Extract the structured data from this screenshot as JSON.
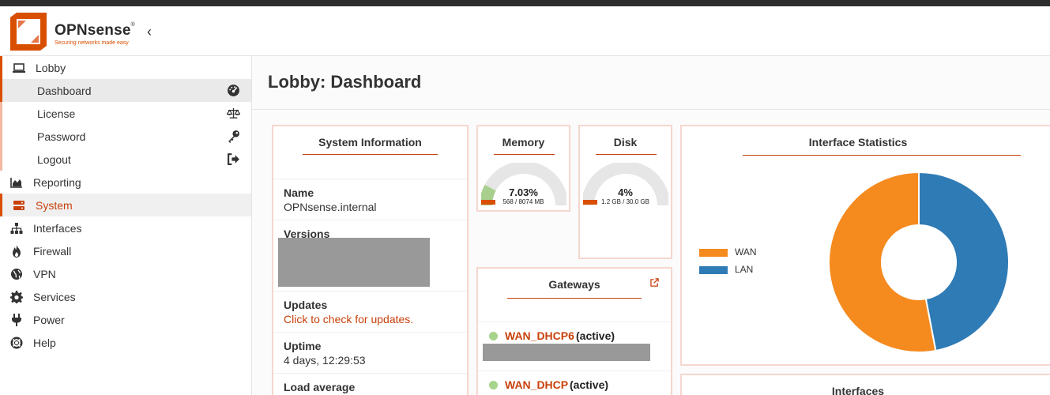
{
  "header": {
    "brand": "OPNsense",
    "brand_mark": "®",
    "tagline": "Securing networks made easy",
    "collapse_icon": "chevron-left-icon",
    "collapse_glyph": "‹"
  },
  "sidebar": {
    "lobby": {
      "label": "Lobby",
      "icon": "laptop-icon"
    },
    "lobby_items": [
      {
        "label": "Dashboard",
        "icon": "dashboard-gauge-icon"
      },
      {
        "label": "License",
        "icon": "balance-scale-icon"
      },
      {
        "label": "Password",
        "icon": "key-icon"
      },
      {
        "label": "Logout",
        "icon": "sign-out-icon"
      }
    ],
    "items": [
      {
        "label": "Reporting",
        "icon": "area-chart-icon"
      },
      {
        "label": "System",
        "icon": "server-icon"
      },
      {
        "label": "Interfaces",
        "icon": "sitemap-icon"
      },
      {
        "label": "Firewall",
        "icon": "fire-icon"
      },
      {
        "label": "VPN",
        "icon": "globe-icon"
      },
      {
        "label": "Services",
        "icon": "cog-icon"
      },
      {
        "label": "Power",
        "icon": "plug-icon"
      },
      {
        "label": "Help",
        "icon": "life-ring-icon"
      }
    ]
  },
  "page": {
    "title": "Lobby: Dashboard"
  },
  "system_info": {
    "title": "System Information",
    "rows": [
      {
        "label": "Name",
        "value": "OPNsense.internal"
      },
      {
        "label": "Versions",
        "value": ""
      },
      {
        "label": "Updates",
        "value": "Click to check for updates."
      },
      {
        "label": "Uptime",
        "value": "4 days, 12:29:53"
      },
      {
        "label": "Load average",
        "value": ""
      }
    ]
  },
  "memory": {
    "title": "Memory",
    "percent_label": "7.03%",
    "usage": "568 / 8074 MB",
    "fraction": 0.0703
  },
  "disk": {
    "title": "Disk",
    "percent_label": "4%",
    "usage": "1.2 GB / 30.0 GB",
    "fraction": 0.04
  },
  "gateways": {
    "title": "Gateways",
    "open_icon": "external-link-icon",
    "items": [
      {
        "name": "WAN_DHCP6",
        "status": "(active)"
      },
      {
        "name": "WAN_DHCP",
        "status": "(active)"
      }
    ]
  },
  "interface_stats": {
    "title": "Interface Statistics",
    "colors": {
      "WAN": "#f58a1f",
      "LAN": "#2f7bb5"
    }
  },
  "interfaces_widget": {
    "title": "Interfaces"
  },
  "chart_data": {
    "type": "pie",
    "categories": [
      "WAN",
      "LAN"
    ],
    "values": [
      53,
      47
    ],
    "legend": "left"
  }
}
